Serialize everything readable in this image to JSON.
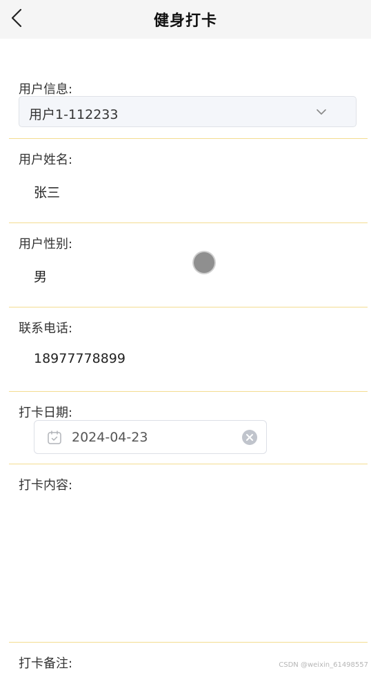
{
  "header": {
    "title": "健身打卡"
  },
  "form": {
    "user_info": {
      "label": "用户信息:",
      "selected": "用户1-112233"
    },
    "user_name": {
      "label": "用户姓名:",
      "value": "张三"
    },
    "user_gender": {
      "label": "用户性别:",
      "value": "男"
    },
    "phone": {
      "label": "联系电话:",
      "value": "18977778899"
    },
    "checkin_date": {
      "label": "打卡日期:",
      "value": "2024-04-23"
    },
    "checkin_content": {
      "label": "打卡内容:"
    },
    "checkin_note": {
      "label": "打卡备注:"
    }
  },
  "watermark": "CSDN @weixin_61498557",
  "colors": {
    "divider": "#f3dc8f",
    "header_bg": "#f5f5f5",
    "select_bg": "#f4f6fa"
  }
}
